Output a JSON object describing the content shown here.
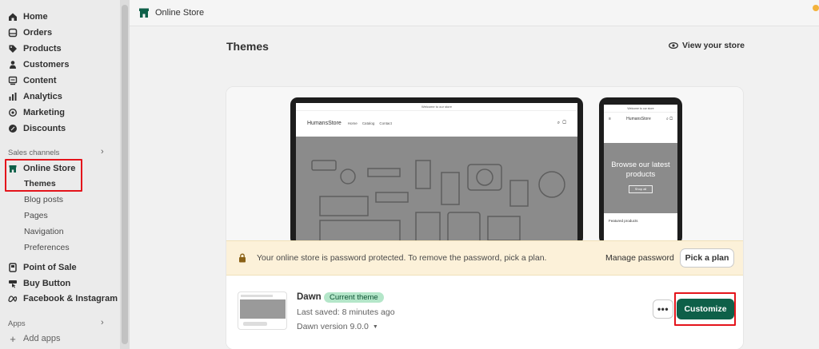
{
  "sidebar": {
    "items": [
      {
        "label": "Home",
        "icon": "home-icon"
      },
      {
        "label": "Orders",
        "icon": "orders-icon"
      },
      {
        "label": "Products",
        "icon": "tag-icon"
      },
      {
        "label": "Customers",
        "icon": "person-icon"
      },
      {
        "label": "Content",
        "icon": "content-icon"
      },
      {
        "label": "Analytics",
        "icon": "analytics-icon"
      },
      {
        "label": "Marketing",
        "icon": "marketing-icon"
      },
      {
        "label": "Discounts",
        "icon": "discount-icon"
      }
    ],
    "sales_channels_label": "Sales channels",
    "online_store": {
      "label": "Online Store",
      "icon": "store-icon"
    },
    "online_store_subitems": [
      "Themes",
      "Blog posts",
      "Pages",
      "Navigation",
      "Preferences"
    ],
    "channels": [
      {
        "label": "Point of Sale",
        "icon": "pos-icon"
      },
      {
        "label": "Buy Button",
        "icon": "buy-button-icon"
      },
      {
        "label": "Facebook & Instagram",
        "icon": "meta-icon"
      }
    ],
    "apps_label": "Apps",
    "add_apps_label": "Add apps"
  },
  "topbar": {
    "title": "Online Store"
  },
  "main": {
    "page_title": "Themes",
    "view_store_label": "View your store",
    "preview": {
      "laptop_banner": "Welcome to our store",
      "laptop_brand": "HumansStore",
      "laptop_nav": [
        "Home",
        "Catalog",
        "Contact"
      ],
      "phone_banner": "Welcome to our store",
      "phone_brand": "HumansStore",
      "phone_hero_text": "Browse our latest products",
      "phone_hero_button": "Shop all",
      "phone_featured": "Featured products"
    },
    "notice": {
      "message": "Your online store is password protected. To remove the password, pick a plan.",
      "manage_password": "Manage password",
      "pick_plan": "Pick a plan"
    },
    "theme": {
      "name": "Dawn",
      "badge": "Current theme",
      "last_saved": "Last saved: 8 minutes ago",
      "version": "Dawn version 9.0.0",
      "more_label": "•••",
      "customize_label": "Customize"
    }
  },
  "colors": {
    "accent": "#0e6049",
    "highlight_box": "#e4141b",
    "badge_bg": "#b4e6c9",
    "notice_bg": "#fcf1d9"
  }
}
